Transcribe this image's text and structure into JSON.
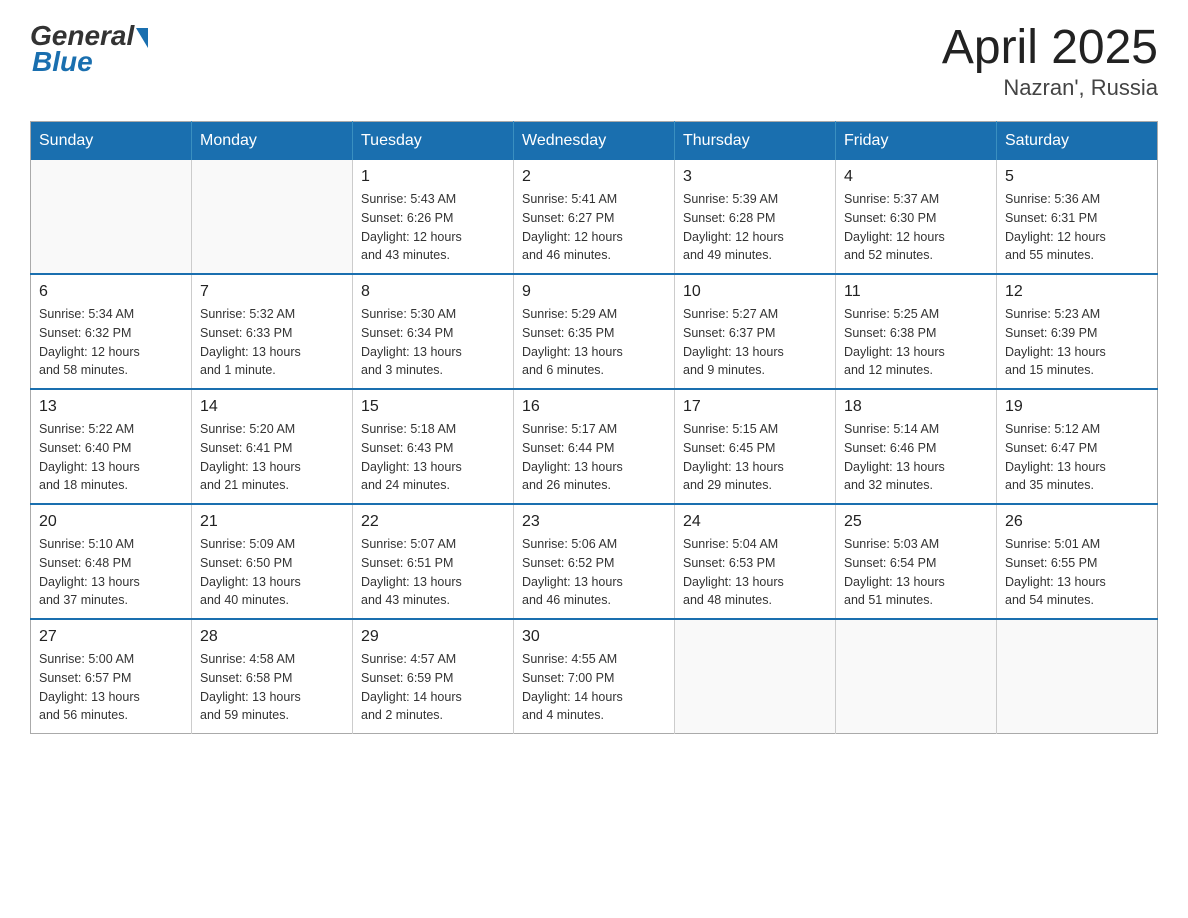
{
  "logo": {
    "general": "General",
    "blue": "Blue"
  },
  "title": "April 2025",
  "subtitle": "Nazran', Russia",
  "weekdays": [
    "Sunday",
    "Monday",
    "Tuesday",
    "Wednesday",
    "Thursday",
    "Friday",
    "Saturday"
  ],
  "weeks": [
    [
      {
        "num": "",
        "info": ""
      },
      {
        "num": "",
        "info": ""
      },
      {
        "num": "1",
        "info": "Sunrise: 5:43 AM\nSunset: 6:26 PM\nDaylight: 12 hours\nand 43 minutes."
      },
      {
        "num": "2",
        "info": "Sunrise: 5:41 AM\nSunset: 6:27 PM\nDaylight: 12 hours\nand 46 minutes."
      },
      {
        "num": "3",
        "info": "Sunrise: 5:39 AM\nSunset: 6:28 PM\nDaylight: 12 hours\nand 49 minutes."
      },
      {
        "num": "4",
        "info": "Sunrise: 5:37 AM\nSunset: 6:30 PM\nDaylight: 12 hours\nand 52 minutes."
      },
      {
        "num": "5",
        "info": "Sunrise: 5:36 AM\nSunset: 6:31 PM\nDaylight: 12 hours\nand 55 minutes."
      }
    ],
    [
      {
        "num": "6",
        "info": "Sunrise: 5:34 AM\nSunset: 6:32 PM\nDaylight: 12 hours\nand 58 minutes."
      },
      {
        "num": "7",
        "info": "Sunrise: 5:32 AM\nSunset: 6:33 PM\nDaylight: 13 hours\nand 1 minute."
      },
      {
        "num": "8",
        "info": "Sunrise: 5:30 AM\nSunset: 6:34 PM\nDaylight: 13 hours\nand 3 minutes."
      },
      {
        "num": "9",
        "info": "Sunrise: 5:29 AM\nSunset: 6:35 PM\nDaylight: 13 hours\nand 6 minutes."
      },
      {
        "num": "10",
        "info": "Sunrise: 5:27 AM\nSunset: 6:37 PM\nDaylight: 13 hours\nand 9 minutes."
      },
      {
        "num": "11",
        "info": "Sunrise: 5:25 AM\nSunset: 6:38 PM\nDaylight: 13 hours\nand 12 minutes."
      },
      {
        "num": "12",
        "info": "Sunrise: 5:23 AM\nSunset: 6:39 PM\nDaylight: 13 hours\nand 15 minutes."
      }
    ],
    [
      {
        "num": "13",
        "info": "Sunrise: 5:22 AM\nSunset: 6:40 PM\nDaylight: 13 hours\nand 18 minutes."
      },
      {
        "num": "14",
        "info": "Sunrise: 5:20 AM\nSunset: 6:41 PM\nDaylight: 13 hours\nand 21 minutes."
      },
      {
        "num": "15",
        "info": "Sunrise: 5:18 AM\nSunset: 6:43 PM\nDaylight: 13 hours\nand 24 minutes."
      },
      {
        "num": "16",
        "info": "Sunrise: 5:17 AM\nSunset: 6:44 PM\nDaylight: 13 hours\nand 26 minutes."
      },
      {
        "num": "17",
        "info": "Sunrise: 5:15 AM\nSunset: 6:45 PM\nDaylight: 13 hours\nand 29 minutes."
      },
      {
        "num": "18",
        "info": "Sunrise: 5:14 AM\nSunset: 6:46 PM\nDaylight: 13 hours\nand 32 minutes."
      },
      {
        "num": "19",
        "info": "Sunrise: 5:12 AM\nSunset: 6:47 PM\nDaylight: 13 hours\nand 35 minutes."
      }
    ],
    [
      {
        "num": "20",
        "info": "Sunrise: 5:10 AM\nSunset: 6:48 PM\nDaylight: 13 hours\nand 37 minutes."
      },
      {
        "num": "21",
        "info": "Sunrise: 5:09 AM\nSunset: 6:50 PM\nDaylight: 13 hours\nand 40 minutes."
      },
      {
        "num": "22",
        "info": "Sunrise: 5:07 AM\nSunset: 6:51 PM\nDaylight: 13 hours\nand 43 minutes."
      },
      {
        "num": "23",
        "info": "Sunrise: 5:06 AM\nSunset: 6:52 PM\nDaylight: 13 hours\nand 46 minutes."
      },
      {
        "num": "24",
        "info": "Sunrise: 5:04 AM\nSunset: 6:53 PM\nDaylight: 13 hours\nand 48 minutes."
      },
      {
        "num": "25",
        "info": "Sunrise: 5:03 AM\nSunset: 6:54 PM\nDaylight: 13 hours\nand 51 minutes."
      },
      {
        "num": "26",
        "info": "Sunrise: 5:01 AM\nSunset: 6:55 PM\nDaylight: 13 hours\nand 54 minutes."
      }
    ],
    [
      {
        "num": "27",
        "info": "Sunrise: 5:00 AM\nSunset: 6:57 PM\nDaylight: 13 hours\nand 56 minutes."
      },
      {
        "num": "28",
        "info": "Sunrise: 4:58 AM\nSunset: 6:58 PM\nDaylight: 13 hours\nand 59 minutes."
      },
      {
        "num": "29",
        "info": "Sunrise: 4:57 AM\nSunset: 6:59 PM\nDaylight: 14 hours\nand 2 minutes."
      },
      {
        "num": "30",
        "info": "Sunrise: 4:55 AM\nSunset: 7:00 PM\nDaylight: 14 hours\nand 4 minutes."
      },
      {
        "num": "",
        "info": ""
      },
      {
        "num": "",
        "info": ""
      },
      {
        "num": "",
        "info": ""
      }
    ]
  ]
}
